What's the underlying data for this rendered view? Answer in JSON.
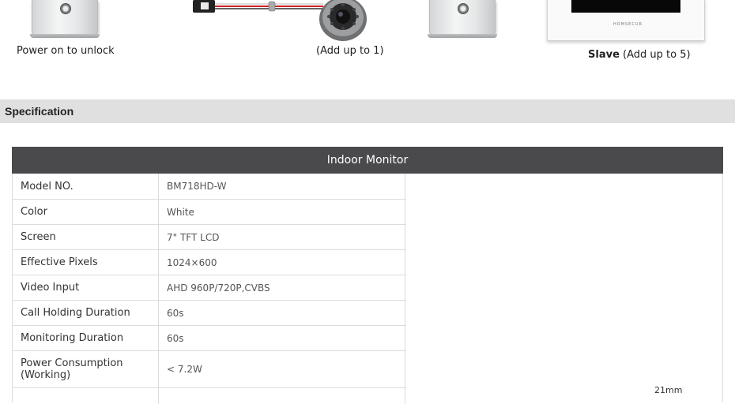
{
  "gallery": {
    "items": [
      {
        "caption": "Power on to unlock"
      },
      {
        "caption": "(Add up to 1)"
      },
      {
        "caption": "Power on to unlock"
      },
      {
        "caption_bold": "Slave",
        "caption": " (Add up to 5)"
      }
    ],
    "monitor_brand": "HOMSECUR"
  },
  "section": {
    "title": "Specification"
  },
  "spec_table": {
    "header": "Indoor Monitor",
    "rows": [
      {
        "label": "Model NO.",
        "value": "BM718HD-W"
      },
      {
        "label": "Color",
        "value": "White"
      },
      {
        "label": "Screen",
        "value": "7\" TFT LCD"
      },
      {
        "label": "Effective Pixels",
        "value": "1024×600"
      },
      {
        "label": "Video Input",
        "value": "AHD 960P/720P,CVBS"
      },
      {
        "label": "Call Holding Duration",
        "value": "60s"
      },
      {
        "label": "Monitoring Duration",
        "value": "60s"
      },
      {
        "label": "Power Consumption (Working)",
        "value": "< 7.2W"
      }
    ],
    "dimension_label": "21mm"
  },
  "colors": {
    "band_bg": "#e0e0e0",
    "header_bg": "#4a4a4c",
    "border": "#dcdcdc"
  }
}
